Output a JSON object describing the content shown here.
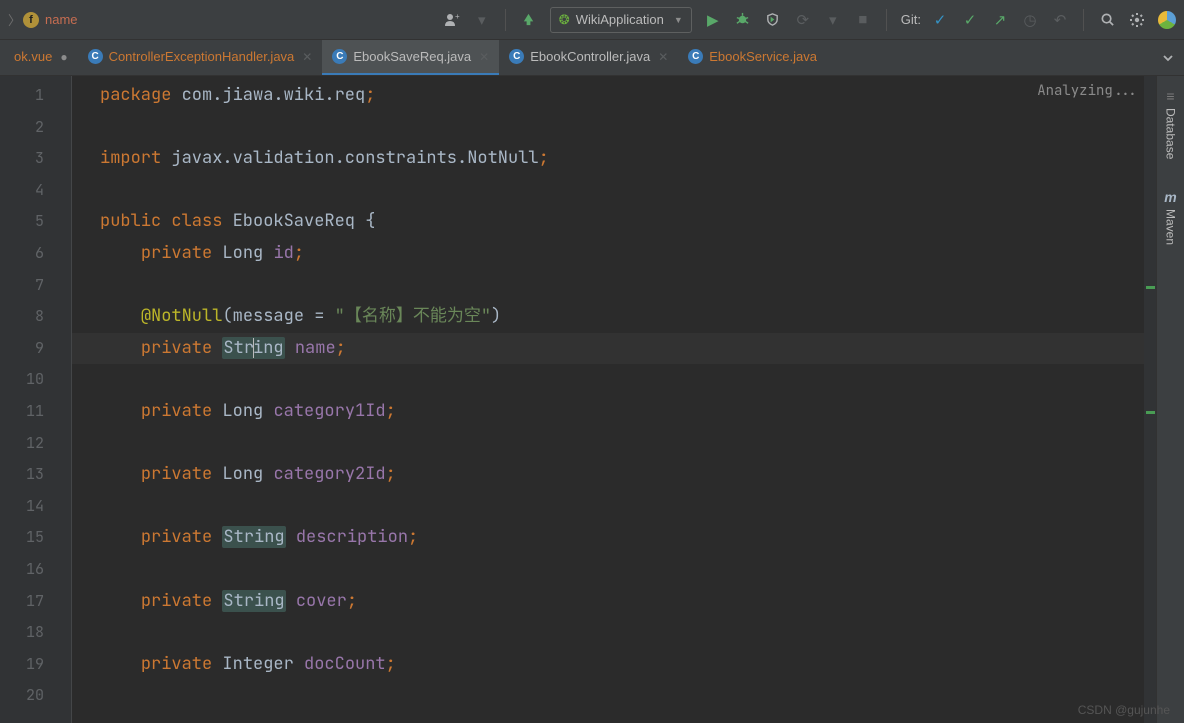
{
  "toolbar": {
    "breadcrumb_icon": "f",
    "breadcrumb_name": "name",
    "run_config": "WikiApplication",
    "git_label": "Git:"
  },
  "tabs": [
    {
      "label": "ok.vue",
      "icon": null,
      "active": false,
      "closeable": true,
      "orange": true,
      "partial": true
    },
    {
      "label": "ControllerExceptionHandler.java",
      "icon": "C",
      "active": false,
      "closeable": true,
      "orange": true
    },
    {
      "label": "EbookSaveReq.java",
      "icon": "C",
      "active": true,
      "closeable": true,
      "orange": false
    },
    {
      "label": "EbookController.java",
      "icon": "C",
      "active": false,
      "closeable": true,
      "orange": false
    },
    {
      "label": "EbookService.java",
      "icon": "C",
      "active": false,
      "closeable": false,
      "orange": true
    }
  ],
  "editor": {
    "status": "Analyzing...",
    "lines": {
      "1": {
        "type": "pkg",
        "text": "com.jiawa.wiki.req"
      },
      "3": {
        "type": "imp",
        "text": "javax.validation.constraints.NotNull"
      },
      "5": {
        "type": "cls",
        "name": "EbookSaveReq"
      },
      "6": {
        "type": "fld",
        "mod": "private",
        "t": "Long",
        "n": "id"
      },
      "8": {
        "type": "ann",
        "name": "@NotNull",
        "arg": "message = ",
        "str": "\"【名称】不能为空\""
      },
      "9": {
        "type": "fld",
        "mod": "private",
        "t": "String",
        "n": "name",
        "hl": true,
        "box": true,
        "caret": 3
      },
      "11": {
        "type": "fld",
        "mod": "private",
        "t": "Long",
        "n": "category1Id"
      },
      "13": {
        "type": "fld",
        "mod": "private",
        "t": "Long",
        "n": "category2Id"
      },
      "15": {
        "type": "fld",
        "mod": "private",
        "t": "String",
        "n": "description",
        "box": true
      },
      "17": {
        "type": "fld",
        "mod": "private",
        "t": "String",
        "n": "cover",
        "box": true
      },
      "19": {
        "type": "fld",
        "mod": "private",
        "t": "Integer",
        "n": "docCount"
      }
    },
    "line_count": 20
  },
  "right_tools": [
    {
      "icon": "≡",
      "label": "Database"
    },
    {
      "icon": "m",
      "label": "Maven"
    }
  ],
  "watermark": "CSDN @gujunhe"
}
